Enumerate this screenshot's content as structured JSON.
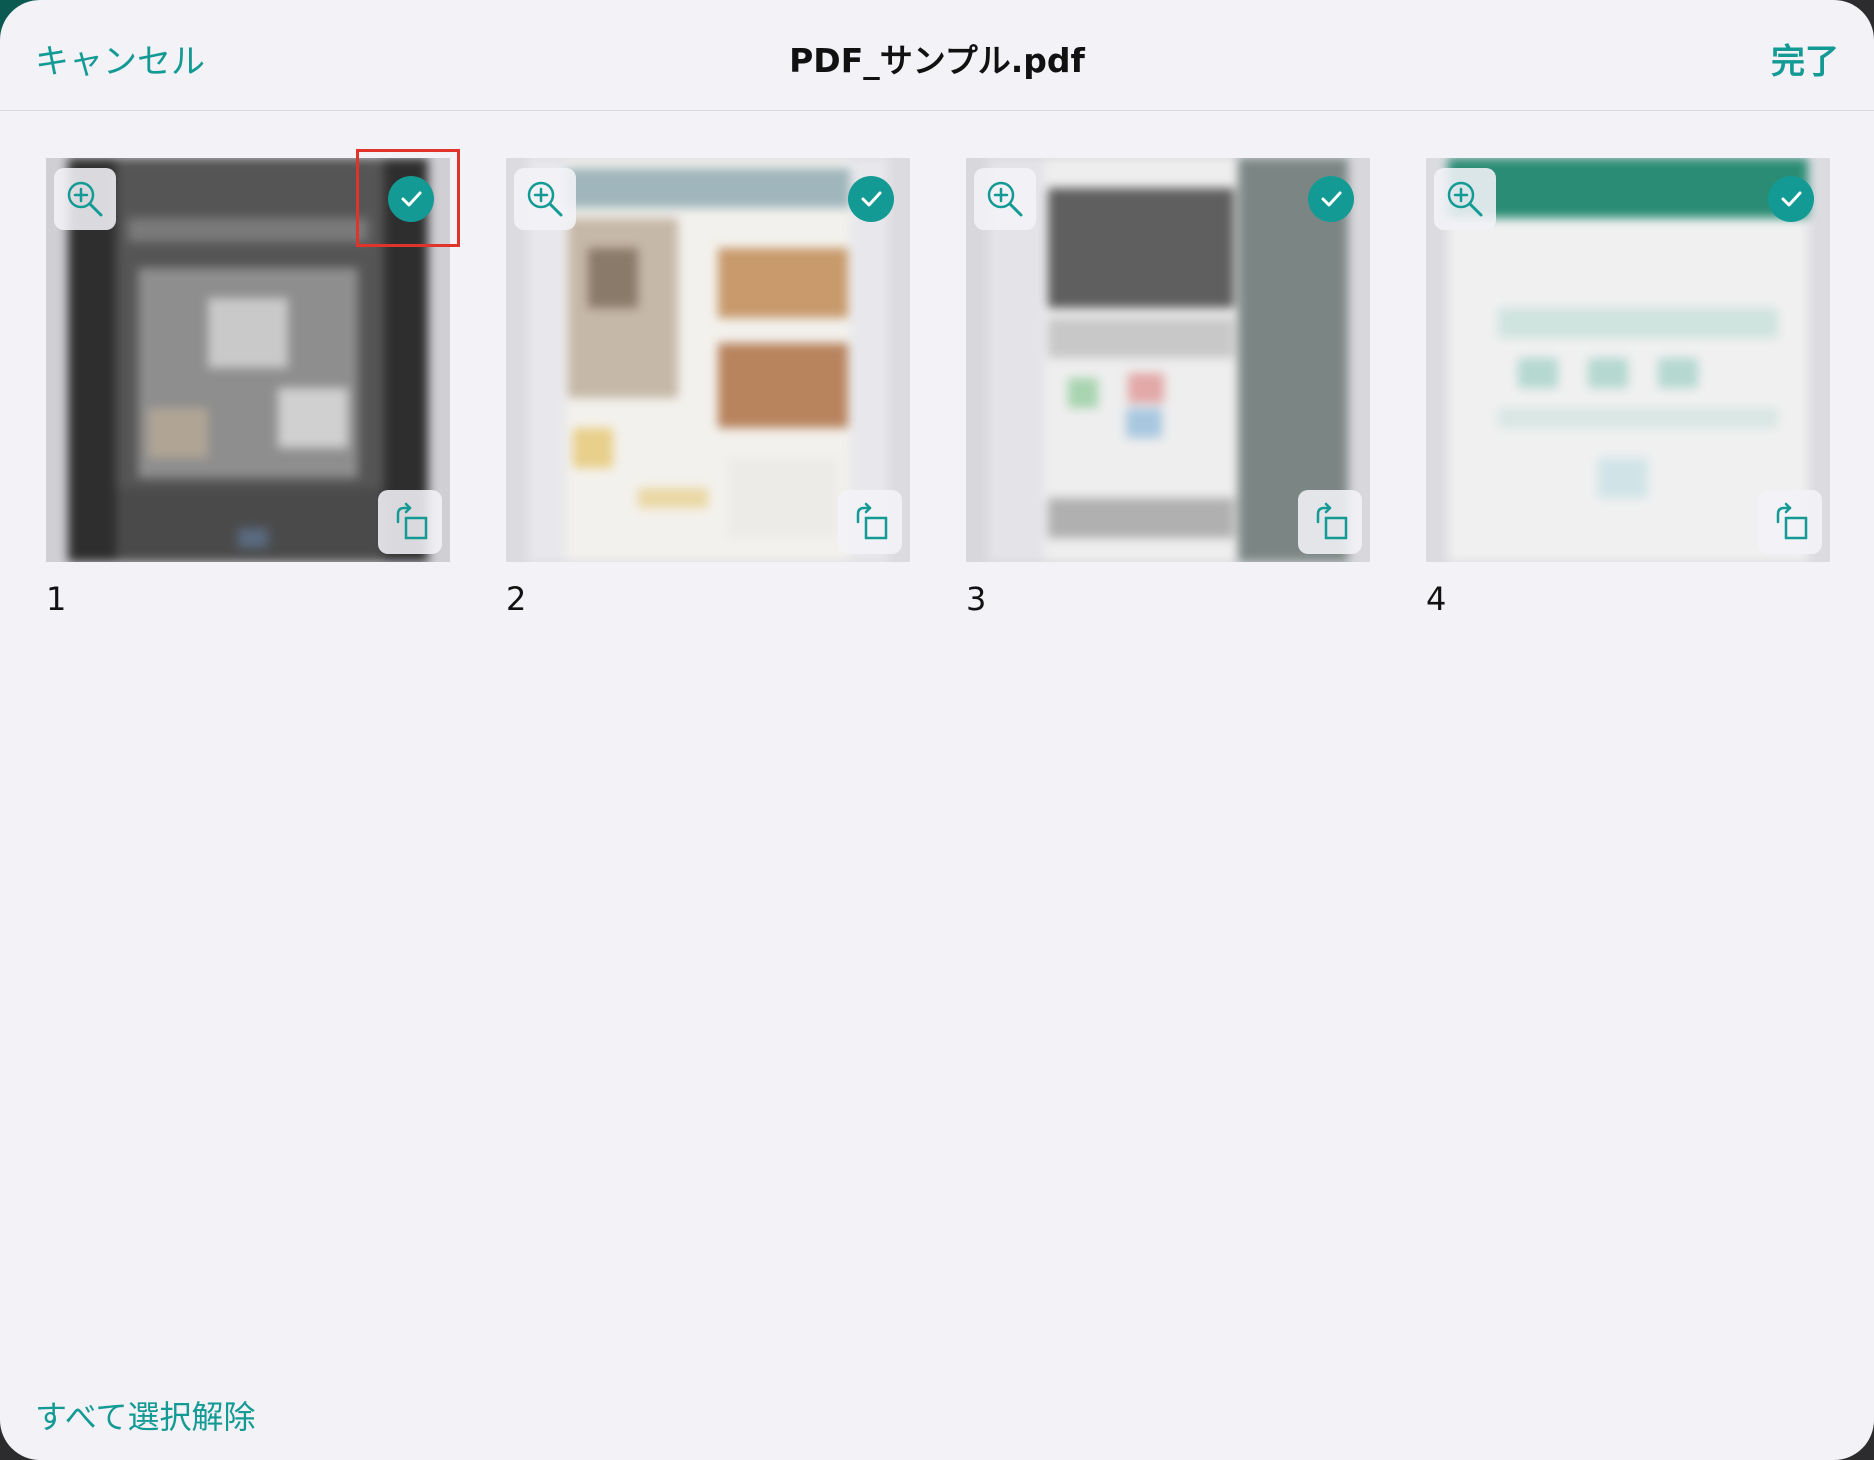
{
  "navbar": {
    "cancel_label": "キャンセル",
    "title": "PDF_サンプル.pdf",
    "done_label": "完了"
  },
  "pages": [
    {
      "number": "1",
      "selected": true
    },
    {
      "number": "2",
      "selected": true
    },
    {
      "number": "3",
      "selected": true
    },
    {
      "number": "4",
      "selected": true
    }
  ],
  "footer": {
    "deselect_all_label": "すべて選択解除"
  },
  "colors": {
    "accent": "#149a94",
    "background": "#f2f2f7",
    "highlight": "#e0332c"
  },
  "icons": {
    "zoom": "zoom-in-icon",
    "check": "checkmark-icon",
    "rotate": "rotate-icon"
  }
}
